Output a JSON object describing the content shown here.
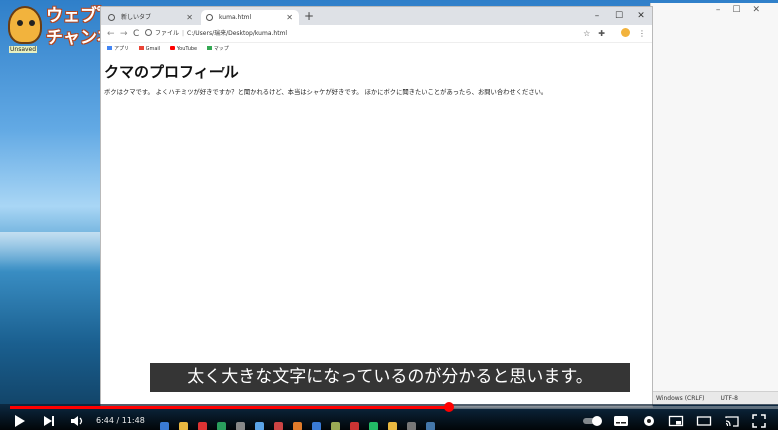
{
  "channel": {
    "logo_line1_a": "ウェブ",
    "logo_line1_b": "ヒ",
    "logo_line2": "チャンネ",
    "badge": "Unsaved"
  },
  "browser": {
    "tabs": [
      {
        "label": "新しいタブ",
        "active": false
      },
      {
        "label": "kuma.html",
        "active": true
      }
    ],
    "new_tab": "+",
    "window_controls": {
      "minimize": "–",
      "maximize": "☐",
      "close": "✕"
    },
    "nav": {
      "back": "←",
      "forward": "→",
      "reload": "C"
    },
    "address": {
      "scheme_label": "ファイル",
      "path": "C:/Users/瑞来/Desktop/kuma.html"
    },
    "bookmarks": [
      {
        "label": "アプリ",
        "icon": "apps-icon",
        "color": "#4285f4"
      },
      {
        "label": "Gmail",
        "icon": "gmail-icon",
        "color": "#ea4335"
      },
      {
        "label": "YouTube",
        "icon": "youtube-icon",
        "color": "#ff0000"
      },
      {
        "label": "マップ",
        "icon": "maps-icon",
        "color": "#34a853"
      }
    ]
  },
  "page": {
    "heading": "クマのプロフィール",
    "body": "ボクはクマです。 よくハチミツが好きですか？と聞かれるけど、本当はシャケが好きです。 ほかにボクに聞きたいことがあったら、お問い合わせください。"
  },
  "editor_status": {
    "line_ending": "Windows (CRLF)",
    "encoding": "UTF-8"
  },
  "subtitle": "太く大きな文字になっているのが分かると思います。",
  "player": {
    "current_time": "6:44",
    "duration": "11:48",
    "progress": 0.571,
    "accent_color": "#ff0000"
  }
}
